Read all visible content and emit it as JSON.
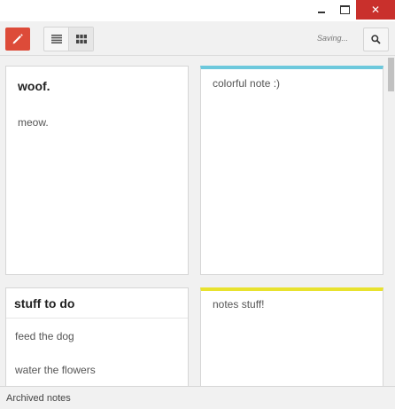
{
  "window": {
    "minimize_icon": "minimize-icon",
    "maximize_icon": "maximize-icon",
    "close_icon": "close-icon",
    "close_glyph": "✕"
  },
  "toolbar": {
    "new_note_icon": "pencil-icon",
    "list_view_icon": "list-icon",
    "grid_view_icon": "grid-icon",
    "active_view": "grid",
    "status": "Saving...",
    "search_icon": "search-icon",
    "accent_color": "#dd4b39"
  },
  "notes": [
    {
      "title": "woof.",
      "text": "meow.",
      "color": "#ffffff"
    },
    {
      "title": "",
      "text": "colorful note :)",
      "color": "#6cc8dc"
    },
    {
      "title": "stuff to do",
      "items": [
        "feed the dog",
        "water the flowers"
      ],
      "color": "#ffffff"
    },
    {
      "title": "",
      "text": "notes stuff!",
      "color": "#e8e22e"
    }
  ],
  "footer": {
    "label": "Archived notes"
  }
}
